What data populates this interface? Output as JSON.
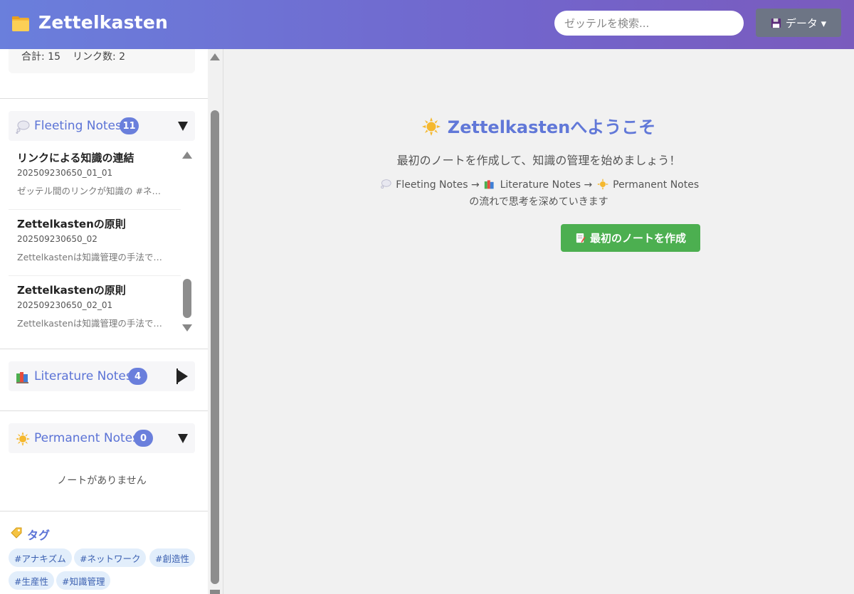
{
  "header": {
    "title": "Zettelkasten",
    "search_placeholder": "ゼッテルを検索...",
    "data_button_label": "データ ▾"
  },
  "stats": {
    "total": "合計: 15",
    "links": "リンク数: 2"
  },
  "sections": {
    "fleeting": {
      "title": "Fleeting Notes",
      "count": "11",
      "expanded": true
    },
    "literature": {
      "title": "Literature Notes",
      "count": "4",
      "expanded": false
    },
    "permanent": {
      "title": "Permanent Notes",
      "count": "0",
      "expanded": true,
      "empty_text": "ノートがありません"
    }
  },
  "fleeting_notes": [
    {
      "title": "リンクによる知識の連結",
      "id": "202509230650_01_01",
      "excerpt": "ゼッテル間のリンクが知識の #ネ…"
    },
    {
      "title": "Zettelkastenの原則",
      "id": "202509230650_02",
      "excerpt": "Zettelkastenは知識管理の手法で…"
    },
    {
      "title": "Zettelkastenの原則",
      "id": "202509230650_02_01",
      "excerpt": "Zettelkastenは知識管理の手法で…"
    }
  ],
  "tags": {
    "title": "タグ",
    "items": [
      "#アナキズム",
      "#ネットワーク",
      "#創造性",
      "#生産性",
      "#知識管理"
    ]
  },
  "welcome": {
    "title": "Zettelkastenへようこそ",
    "subtitle": "最初のノートを作成して、知識の管理を始めましょう！",
    "flow_fleeting": "Fleeting Notes",
    "flow_arrow": "→",
    "flow_literature": "Literature Notes",
    "flow_permanent": "Permanent Notes",
    "flow_tail": "の流れで思考を深めていきます",
    "create_button_label": "最初のノートを作成"
  },
  "colors": {
    "accent": "#6178d8",
    "badge": "#6a7fdc",
    "create_button": "#4caf50",
    "tag_bg": "#e2eefb"
  }
}
